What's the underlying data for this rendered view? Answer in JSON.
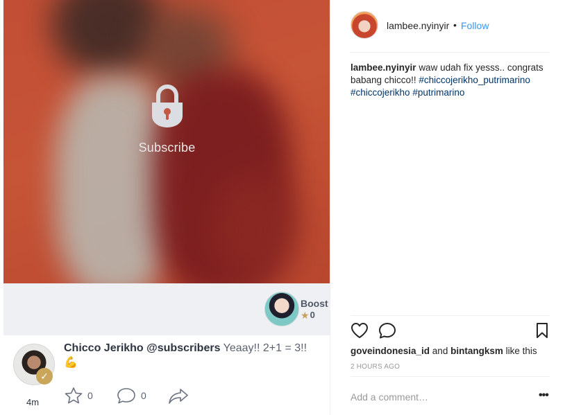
{
  "media": {
    "lock_label": "Subscribe",
    "boost_label": "Boost",
    "boost_count": "0",
    "post": {
      "author": "Chicco Jerikho @subscribers",
      "message": "Yeaay!! 2+1 = 3!!",
      "emoji": "💪",
      "time": "4m",
      "like_count": "0",
      "comment_count": "0"
    }
  },
  "side": {
    "username": "lambee.nyinyir",
    "dot": "•",
    "follow_label": "Follow",
    "caption": {
      "user": "lambee.nyinyir",
      "text": "waw udah fix yesss.. congrats babang chicco!!",
      "tags": [
        "#chiccojerikho_putrimarino",
        "#chiccojerikho",
        "#putrimarino"
      ]
    },
    "likes": {
      "user1": "goveindonesia_id",
      "and": "and",
      "user2": "bintangksm",
      "suffix": "like this"
    },
    "time_ago": "2 HOURS AGO",
    "comment_placeholder": "Add a comment…",
    "more_label": "•••"
  },
  "colors": {
    "follow": "#3897f0",
    "hashtag": "#003569",
    "photo_bg": "#c24e35",
    "boost_bar": "#eef0f4"
  },
  "icons": {
    "lock": "padlock-icon",
    "star": "star-icon",
    "heart": "heart-icon",
    "comment": "speech-bubble-icon",
    "share": "share-arrow-icon",
    "bookmark": "bookmark-icon",
    "more": "ellipsis-icon"
  }
}
